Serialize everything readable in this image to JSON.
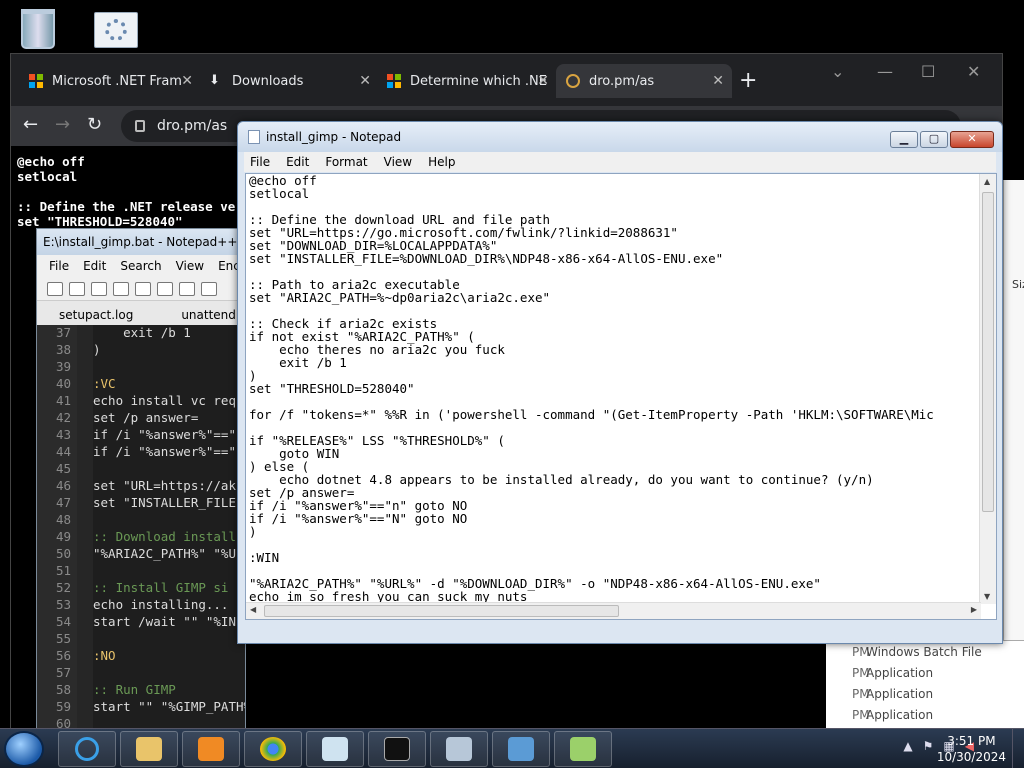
{
  "browser": {
    "tabs": [
      {
        "label": "Microsoft .NET Fram",
        "icon": "microsoft-logo-icon"
      },
      {
        "label": "Downloads",
        "icon": "download-icon"
      },
      {
        "label": "Determine which .NE",
        "icon": "microsoft-logo-icon"
      },
      {
        "label": "dro.pm/as",
        "icon": "globe-icon"
      }
    ],
    "new_tab": "+",
    "url": "dro.pm/as",
    "page_text": "@echo off\nsetlocal\n\n:: Define the .NET release vers\nset \"THRESHOLD=528040\""
  },
  "npp": {
    "title": "E:\\install_gimp.bat - Notepad++",
    "menu": [
      "File",
      "Edit",
      "Search",
      "View",
      "Encod"
    ],
    "tabs": [
      "setupact.log",
      "unattend.xn"
    ],
    "lines": [
      {
        "n": "37",
        "t": "    exit /b 1"
      },
      {
        "n": "38",
        "t": ")"
      },
      {
        "n": "39",
        "t": ""
      },
      {
        "n": "40",
        "t": ":VC"
      },
      {
        "n": "41",
        "t": "echo install vc req"
      },
      {
        "n": "42",
        "t": "set /p answer="
      },
      {
        "n": "43",
        "t": "if /i \"%answer%\"==\""
      },
      {
        "n": "44",
        "t": "if /i \"%answer%\"==\""
      },
      {
        "n": "45",
        "t": ""
      },
      {
        "n": "46",
        "t": "set \"URL=https://ak"
      },
      {
        "n": "47",
        "t": "set \"INSTALLER_FILE"
      },
      {
        "n": "48",
        "t": ""
      },
      {
        "n": "49",
        "t": ":: Download install"
      },
      {
        "n": "50",
        "t": "\"%ARIA2C_PATH%\" \"%U"
      },
      {
        "n": "51",
        "t": ""
      },
      {
        "n": "52",
        "t": ":: Install GIMP si"
      },
      {
        "n": "53",
        "t": "echo installing..."
      },
      {
        "n": "54",
        "t": "start /wait \"\" \"%IN"
      },
      {
        "n": "55",
        "t": ""
      },
      {
        "n": "56",
        "t": ":NO"
      },
      {
        "n": "57",
        "t": ""
      },
      {
        "n": "58",
        "t": ":: Run GIMP"
      },
      {
        "n": "59",
        "t": "start \"\" \"%GIMP_PATH%\""
      },
      {
        "n": "60",
        "t": ""
      }
    ]
  },
  "notepad": {
    "title": "install_gimp - Notepad",
    "menu": [
      "File",
      "Edit",
      "Format",
      "View",
      "Help"
    ],
    "content": "@echo off\nsetlocal\n\n:: Define the download URL and file path\nset \"URL=https://go.microsoft.com/fwlink/?linkid=2088631\"\nset \"DOWNLOAD_DIR=%LOCALAPPDATA%\"\nset \"INSTALLER_FILE=%DOWNLOAD_DIR%\\NDP48-x86-x64-AllOS-ENU.exe\"\n\n:: Path to aria2c executable\nset \"ARIA2C_PATH=%~dp0aria2c\\aria2c.exe\"\n\n:: Check if aria2c exists\nif not exist \"%ARIA2C_PATH%\" (\n    echo theres no aria2c you fuck\n    exit /b 1\n)\nset \"THRESHOLD=528040\"\n\nfor /f \"tokens=*\" %%R in ('powershell -command \"(Get-ItemProperty -Path 'HKLM:\\SOFTWARE\\Mic\n\nif \"%RELEASE%\" LSS \"%THRESHOLD%\" (\n    goto WIN\n) else (\n    echo dotnet 4.8 appears to be installed already, do you want to continue? (y/n)\nset /p answer=\nif /i \"%answer%\"==\"n\" goto NO\nif /i \"%answer%\"==\"N\" goto NO\n)\n\n:WIN\n\n\"%ARIA2C_PATH%\" \"%URL%\" -d \"%DOWNLOAD_DIR%\" -o \"NDP48-x86-x64-AllOS-ENU.exe\"\necho im so fresh you can suck my nuts\nstart /wait \"\" \"%INSTALLER_FILE%\" /silent /suppressmsgboxes /norestart /sp-"
  },
  "side_window": {
    "column": "Siz"
  },
  "explorer": {
    "rows": [
      {
        "time": "PM",
        "type": "Windows Batch File"
      },
      {
        "time": "PM",
        "type": "Application"
      },
      {
        "time": "PM",
        "type": "Application"
      },
      {
        "time": "PM",
        "type": "Application"
      }
    ]
  },
  "taskbar": {
    "time": "3:51 PM",
    "date": "10/30/2024"
  },
  "colors": {
    "taskbar": "#1c2a3e",
    "chrome_bg": "#202124",
    "npp_bg": "#1e1e1e"
  }
}
